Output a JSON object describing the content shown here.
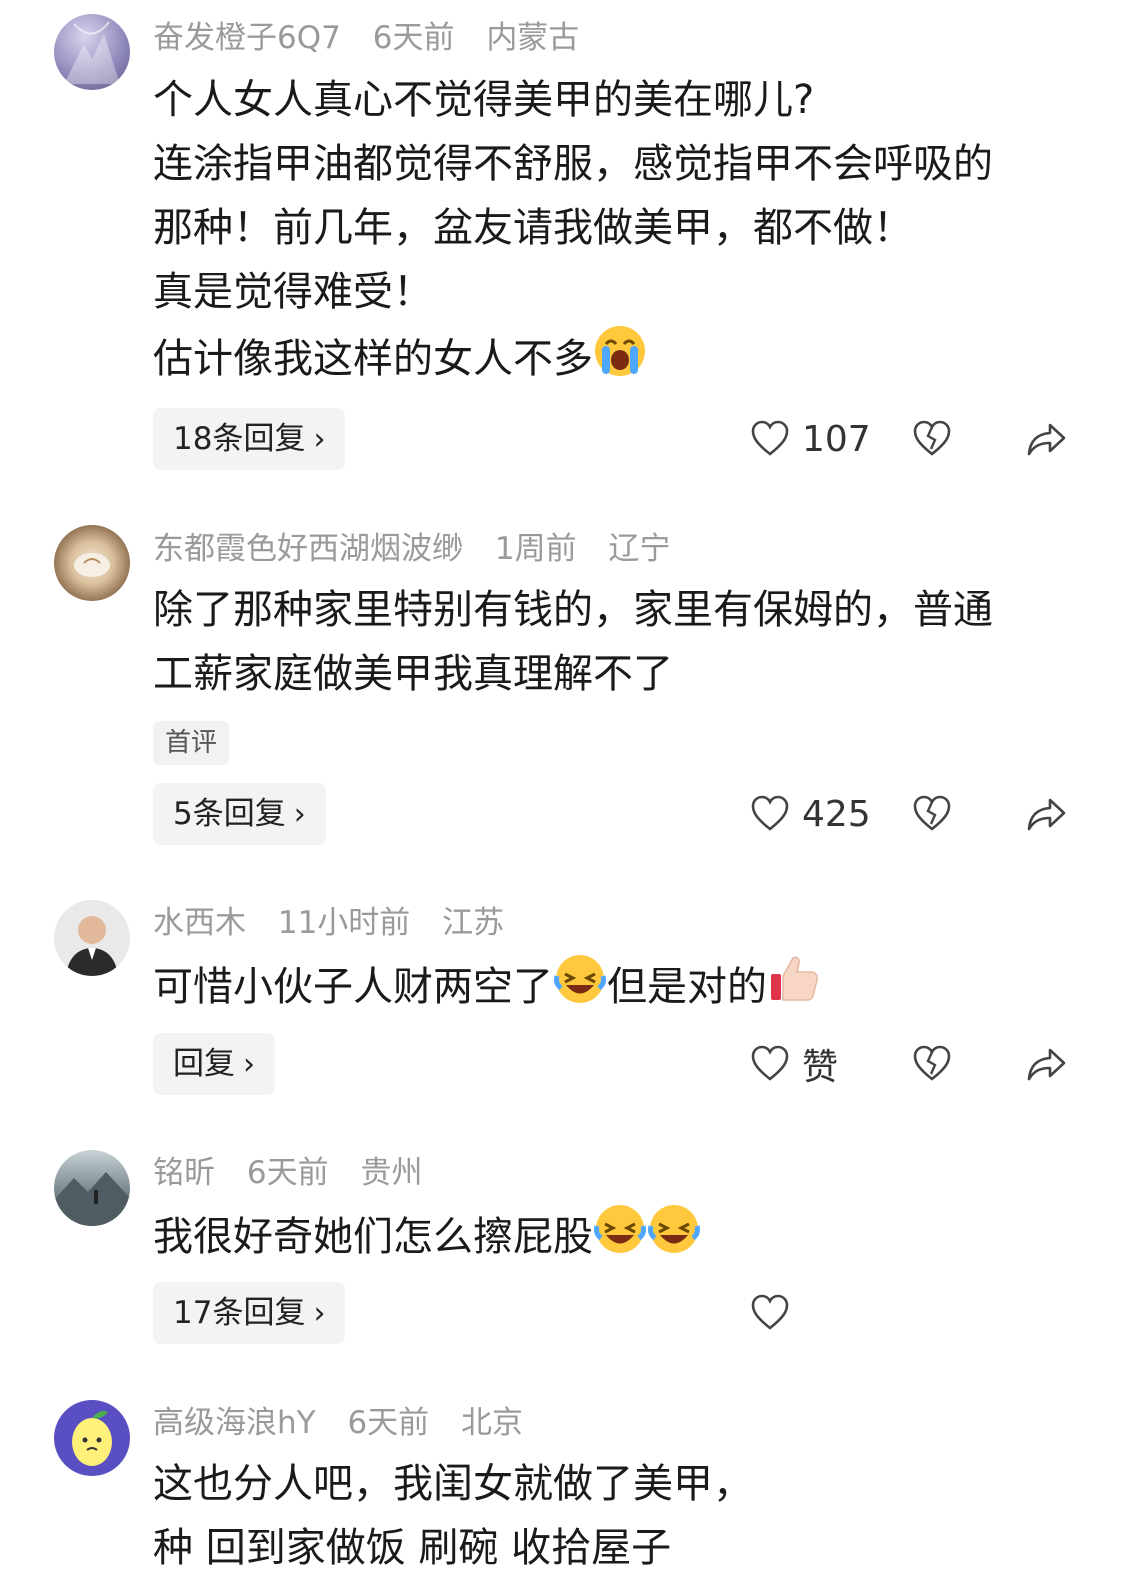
{
  "comments": [
    {
      "username": "奋发橙子6Q7",
      "time": "6天前",
      "location": "内蒙古",
      "lines": [
        "个人女人真心不觉得美甲的美在哪儿?",
        "连涂指甲油都觉得不舒服，感觉指甲不会呼吸的",
        "那种！前几年，盆友请我做美甲，都不做！",
        "真是觉得难受！",
        "估计像我这样的女人不多"
      ],
      "reply_label": "18条回复",
      "likes": "107",
      "avatar_color": "#8b86b8"
    },
    {
      "username": "东都霞色好西湖烟波缈",
      "time": "1周前",
      "location": "辽宁",
      "lines": [
        "除了那种家里特别有钱的，家里有保姆的，普通",
        "工薪家庭做美甲我真理解不了"
      ],
      "badge": "首评",
      "reply_label": "5条回复",
      "likes": "425",
      "avatar_color": "#c9b49a"
    },
    {
      "username": "水西木",
      "time": "11小时前",
      "location": "江苏",
      "line_a": "可惜小伙子人财两空了",
      "line_b": "但是对的",
      "reply_label": "回复",
      "likes": "赞",
      "avatar_color": "#d8d8d8"
    },
    {
      "username": "铭昕",
      "time": "6天前",
      "location": "贵州",
      "lines": [
        "我很好奇她们怎么擦屁股"
      ],
      "reply_label": "17条回复",
      "avatar_color": "#6f7f86"
    },
    {
      "username": "高级海浪hY",
      "time": "6天前",
      "location": "北京",
      "lines": [
        "这也分人吧，我闺女就做了美甲，",
        "种 回到家做饭 刷碗 收拾屋子"
      ],
      "avatar_color": "#5a4fc2"
    }
  ]
}
